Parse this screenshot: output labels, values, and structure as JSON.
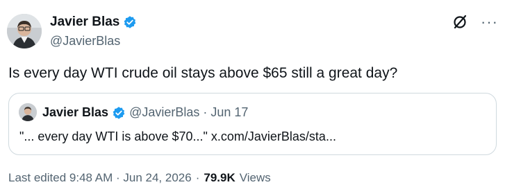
{
  "author": {
    "name": "Javier Blas",
    "handle": "@JavierBlas"
  },
  "tweet": {
    "text": "Is every day WTI crude oil stays above $65 still a great day?"
  },
  "quoted": {
    "name": "Javier Blas",
    "handle": "@JavierBlas",
    "separator": "·",
    "date": "Jun 17",
    "text": "\"... every day WTI is above $70...\" x.com/JavierBlas/sta..."
  },
  "meta": {
    "edited": "Last edited 9:48 AM · Jun 24, 2026",
    "separator": "·",
    "views_count": "79.9K",
    "views_label": "Views"
  },
  "icons": {
    "verified": "verified-badge-icon",
    "grok": "grok-icon",
    "more": "more-icon"
  },
  "colors": {
    "verified": "#1d9bf0",
    "secondary_text": "#536471",
    "border": "#cfd9de"
  }
}
